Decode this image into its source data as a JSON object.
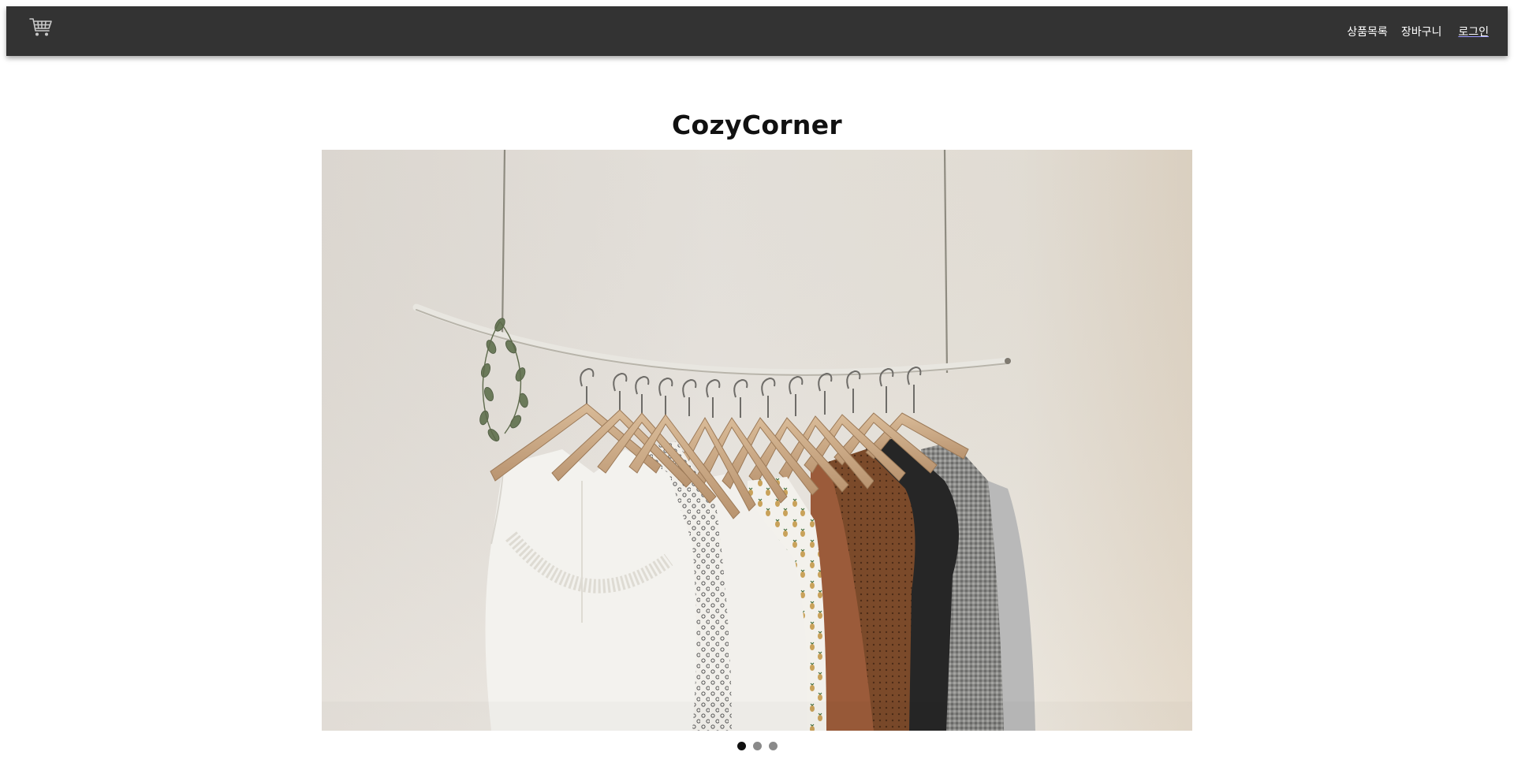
{
  "navbar": {
    "logo_icon": "shopping-cart-icon",
    "links": [
      {
        "label": "상품목록"
      },
      {
        "label": "장바구니"
      },
      {
        "label": "로그인"
      }
    ],
    "background_color": "#333333"
  },
  "hero": {
    "title": "CozyCorner"
  },
  "carousel": {
    "slide_count": 3,
    "active_index": 0,
    "slide_image": "clothes-rack-photo"
  }
}
